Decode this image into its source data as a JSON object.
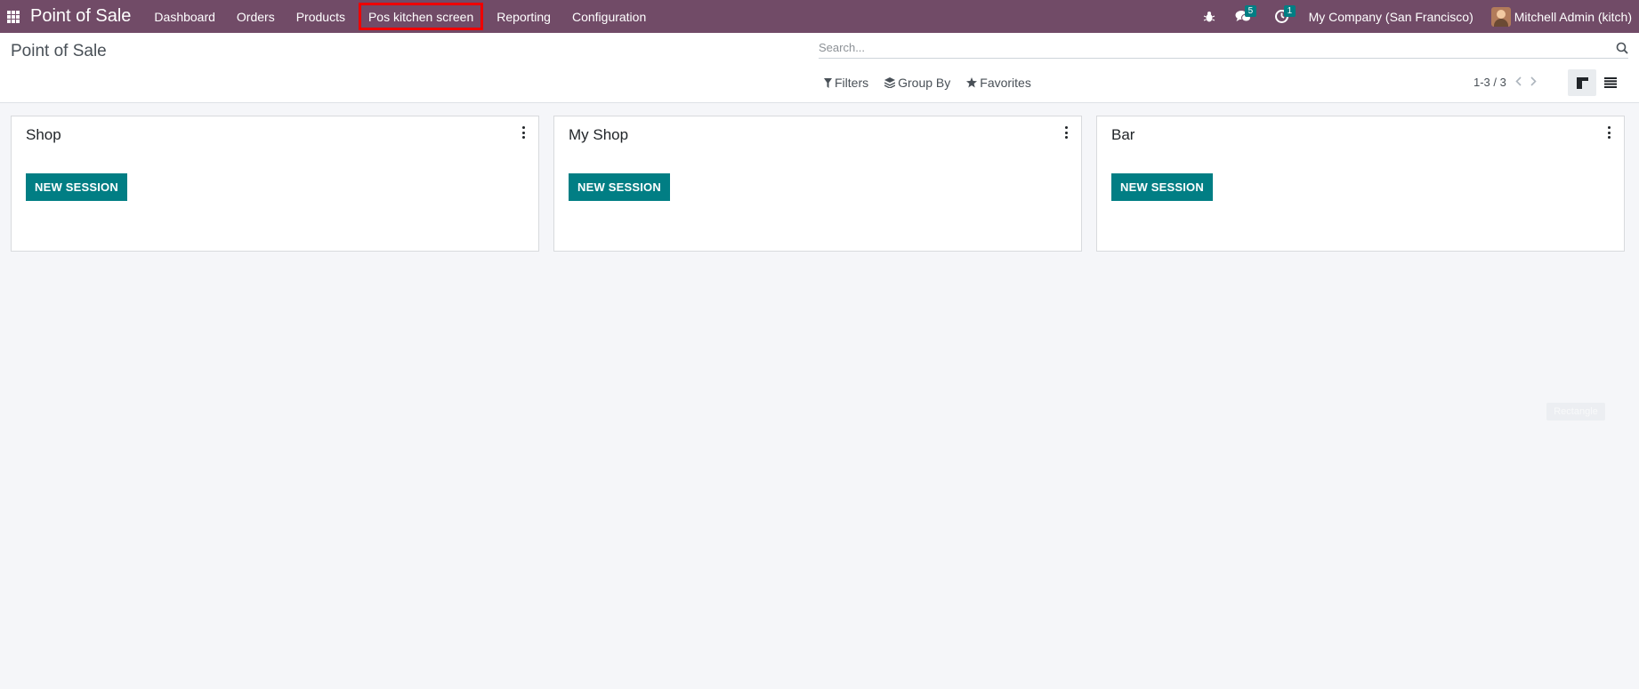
{
  "navbar": {
    "app_name": "Point of Sale",
    "menu": [
      {
        "label": "Dashboard"
      },
      {
        "label": "Orders"
      },
      {
        "label": "Products"
      },
      {
        "label": "Pos kitchen screen"
      },
      {
        "label": "Reporting"
      },
      {
        "label": "Configuration"
      }
    ],
    "messages_count": "5",
    "activities_count": "1",
    "company": "My Company (San Francisco)",
    "user": "Mitchell Admin (kitch)",
    "accent_color": "#714b67",
    "icons": [
      "apps-grid-icon",
      "bug-icon",
      "chat-icon",
      "clock-icon"
    ]
  },
  "control_panel": {
    "title": "Point of Sale",
    "search_placeholder": "Search...",
    "filters_label": "Filters",
    "group_by_label": "Group By",
    "favorites_label": "Favorites",
    "pager": "1-3 / 3",
    "views": [
      "kanban-view-icon",
      "list-view-icon"
    ]
  },
  "cards": [
    {
      "title": "Shop",
      "button": "NEW SESSION"
    },
    {
      "title": "My Shop",
      "button": "NEW SESSION"
    },
    {
      "title": "Bar",
      "button": "NEW SESSION"
    }
  ],
  "button_color": "#017e84",
  "tooltip": "Rectangle"
}
